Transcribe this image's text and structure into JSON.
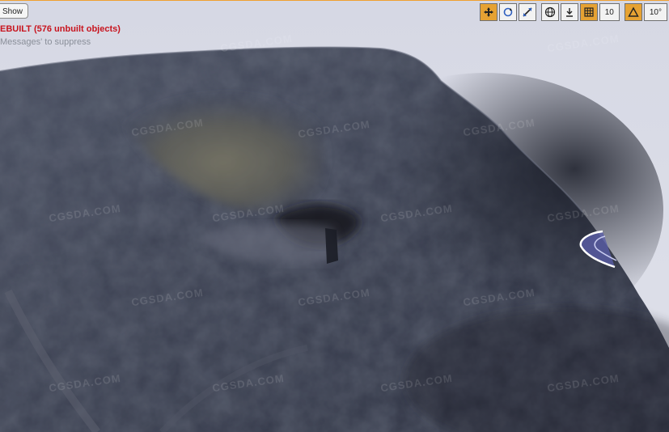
{
  "viewport": {
    "show_button_label": "Show",
    "error_message": "EBUILT (576 unbuilt objects)",
    "hint_message": "Messages' to suppress"
  },
  "toolbar": {
    "items": [
      {
        "icon": "translate-icon",
        "active": true
      },
      {
        "icon": "rotate-icon",
        "active": false
      },
      {
        "icon": "scale-icon",
        "active": false
      },
      {
        "icon": "world-local-icon",
        "active": false
      },
      {
        "icon": "surface-snap-icon",
        "active": false
      },
      {
        "icon": "grid-snap-icon",
        "active": true
      },
      {
        "icon": "angle-snap-icon",
        "active": true
      }
    ],
    "grid_snap_value": "10",
    "rotation_snap_value": "10°"
  },
  "colors": {
    "accent": "#e6a233",
    "error": "#c8141e",
    "sky": "#d9dbe6",
    "rock": "#3a3f4e"
  },
  "watermark_text": "CGSDA.COM"
}
